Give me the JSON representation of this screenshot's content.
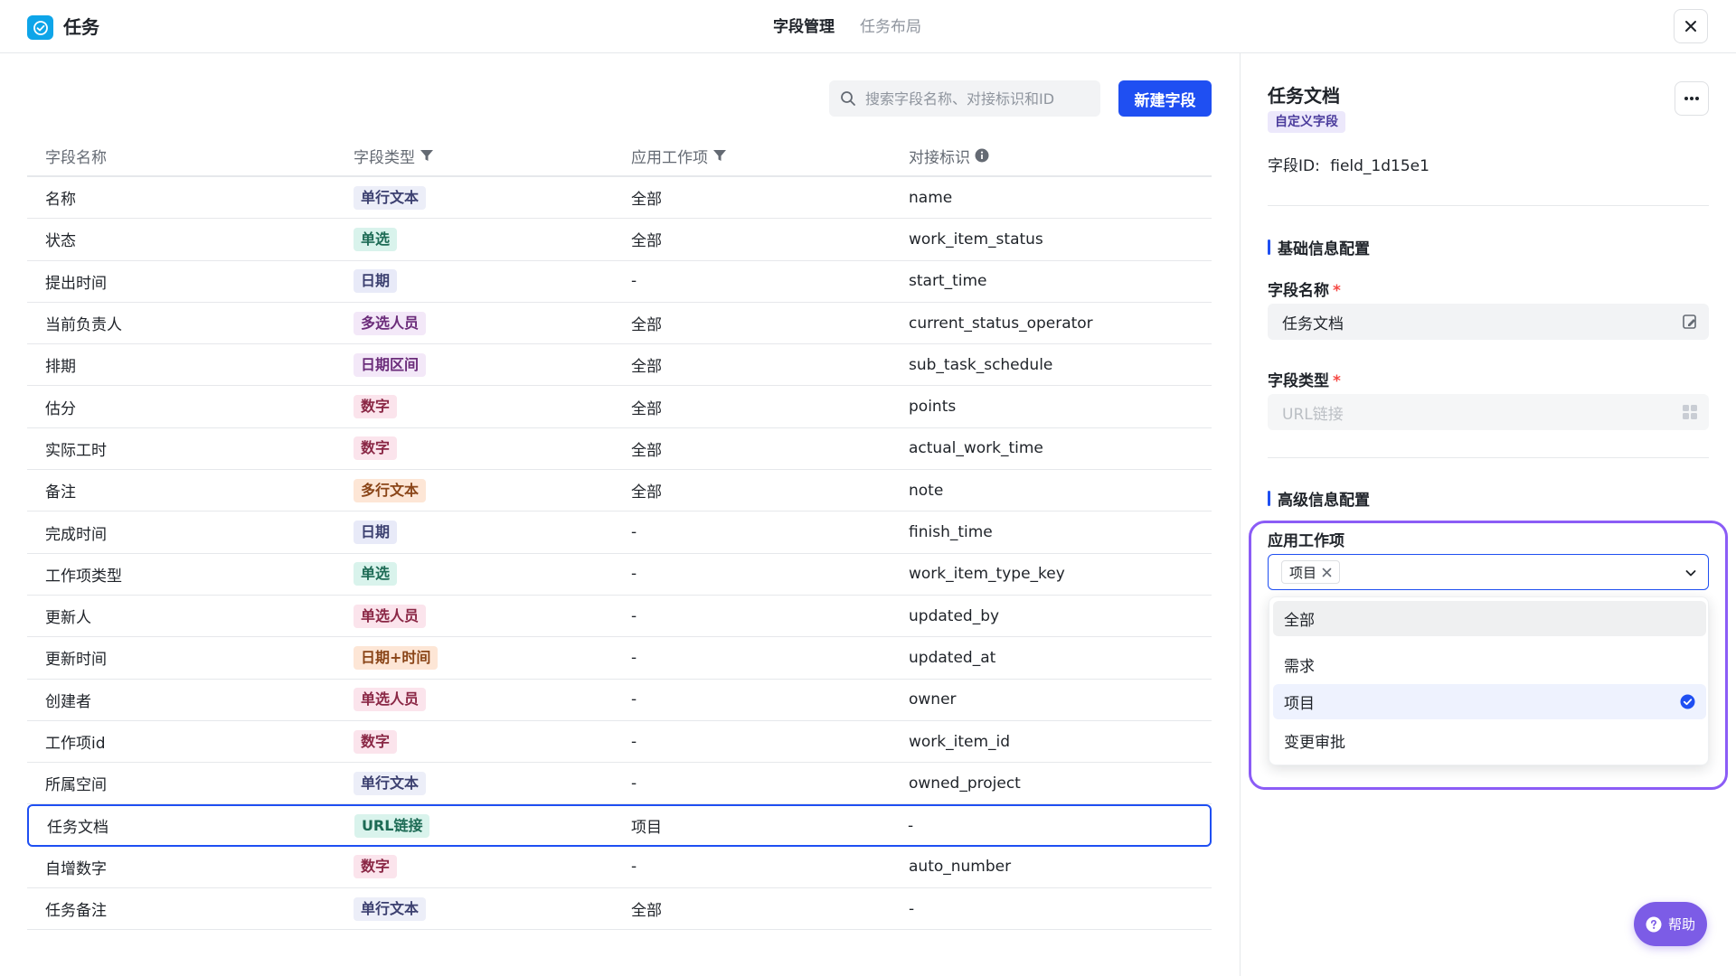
{
  "app": {
    "title": "任务"
  },
  "tabs": [
    {
      "label": "字段管理",
      "active": true
    },
    {
      "label": "任务布局",
      "active": false
    }
  ],
  "toolbar": {
    "search_placeholder": "搜索字段名称、对接标识和ID",
    "new_button": "新建字段"
  },
  "table": {
    "headers": {
      "name": "字段名称",
      "type": "字段类型",
      "apply": "应用工作项",
      "key": "对接标识"
    },
    "rows": [
      {
        "name": "名称",
        "type": "单行文本",
        "type_bg": "#eceef8",
        "type_fg": "#3c4070",
        "apply": "全部",
        "key": "name"
      },
      {
        "name": "状态",
        "type": "单选",
        "type_bg": "#d9f3ec",
        "type_fg": "#1d6b55",
        "apply": "全部",
        "key": "work_item_status"
      },
      {
        "name": "提出时间",
        "type": "日期",
        "type_bg": "#e8eaf8",
        "type_fg": "#3c4070",
        "apply": "-",
        "key": "start_time"
      },
      {
        "name": "当前负责人",
        "type": "多选人员",
        "type_bg": "#f3e8f8",
        "type_fg": "#6b2c7a",
        "apply": "全部",
        "key": "current_status_operator"
      },
      {
        "name": "排期",
        "type": "日期区间",
        "type_bg": "#f3e8f8",
        "type_fg": "#6b2c7a",
        "apply": "全部",
        "key": "sub_task_schedule"
      },
      {
        "name": "估分",
        "type": "数字",
        "type_bg": "#fbe4ec",
        "type_fg": "#8a2745",
        "apply": "全部",
        "key": "points"
      },
      {
        "name": "实际工时",
        "type": "数字",
        "type_bg": "#fbe4ec",
        "type_fg": "#8a2745",
        "apply": "全部",
        "key": "actual_work_time"
      },
      {
        "name": "备注",
        "type": "多行文本",
        "type_bg": "#fde6d6",
        "type_fg": "#8a4518",
        "apply": "全部",
        "key": "note"
      },
      {
        "name": "完成时间",
        "type": "日期",
        "type_bg": "#e8eaf8",
        "type_fg": "#3c4070",
        "apply": "-",
        "key": "finish_time"
      },
      {
        "name": "工作项类型",
        "type": "单选",
        "type_bg": "#d9f3ec",
        "type_fg": "#1d6b55",
        "apply": "-",
        "key": "work_item_type_key"
      },
      {
        "name": "更新人",
        "type": "单选人员",
        "type_bg": "#fbe4ec",
        "type_fg": "#8a2745",
        "apply": "-",
        "key": "updated_by"
      },
      {
        "name": "更新时间",
        "type": "日期+时间",
        "type_bg": "#fde6d6",
        "type_fg": "#8a4518",
        "apply": "-",
        "key": "updated_at"
      },
      {
        "name": "创建者",
        "type": "单选人员",
        "type_bg": "#fbe4ec",
        "type_fg": "#8a2745",
        "apply": "-",
        "key": "owner"
      },
      {
        "name": "工作项id",
        "type": "数字",
        "type_bg": "#fbe4ec",
        "type_fg": "#8a2745",
        "apply": "-",
        "key": "work_item_id"
      },
      {
        "name": "所属空间",
        "type": "单行文本",
        "type_bg": "#eceef8",
        "type_fg": "#3c4070",
        "apply": "-",
        "key": "owned_project"
      },
      {
        "name": "任务文档",
        "type": "URL链接",
        "type_bg": "#d9f3ec",
        "type_fg": "#1d6b55",
        "apply": "项目",
        "key": "-",
        "selected": true
      },
      {
        "name": "自增数字",
        "type": "数字",
        "type_bg": "#fbe4ec",
        "type_fg": "#8a2745",
        "apply": "-",
        "key": "auto_number"
      },
      {
        "name": "任务备注",
        "type": "单行文本",
        "type_bg": "#eceef8",
        "type_fg": "#3c4070",
        "apply": "全部",
        "key": "-"
      }
    ]
  },
  "panel": {
    "title": "任务文档",
    "badge": "自定义字段",
    "field_id_label": "字段ID:",
    "field_id_value": "field_1d15e1",
    "basic_section": "基础信息配置",
    "name_label": "字段名称",
    "name_value": "任务文档",
    "type_label": "字段类型",
    "type_value": "URL链接",
    "required_mark": "*",
    "advanced_section": "高级信息配置",
    "apply_label": "应用工作项",
    "apply_chip": "项目",
    "options": [
      {
        "label": "全部",
        "state": "hover"
      },
      {
        "label": "需求",
        "state": ""
      },
      {
        "label": "项目",
        "state": "checked"
      },
      {
        "label": "变更审批",
        "state": ""
      }
    ]
  },
  "help": {
    "label": "帮助"
  },
  "colors": {
    "primary": "#1f4ff2",
    "highlight": "#8b5cf6",
    "help_bg": "#7c5ce6"
  }
}
